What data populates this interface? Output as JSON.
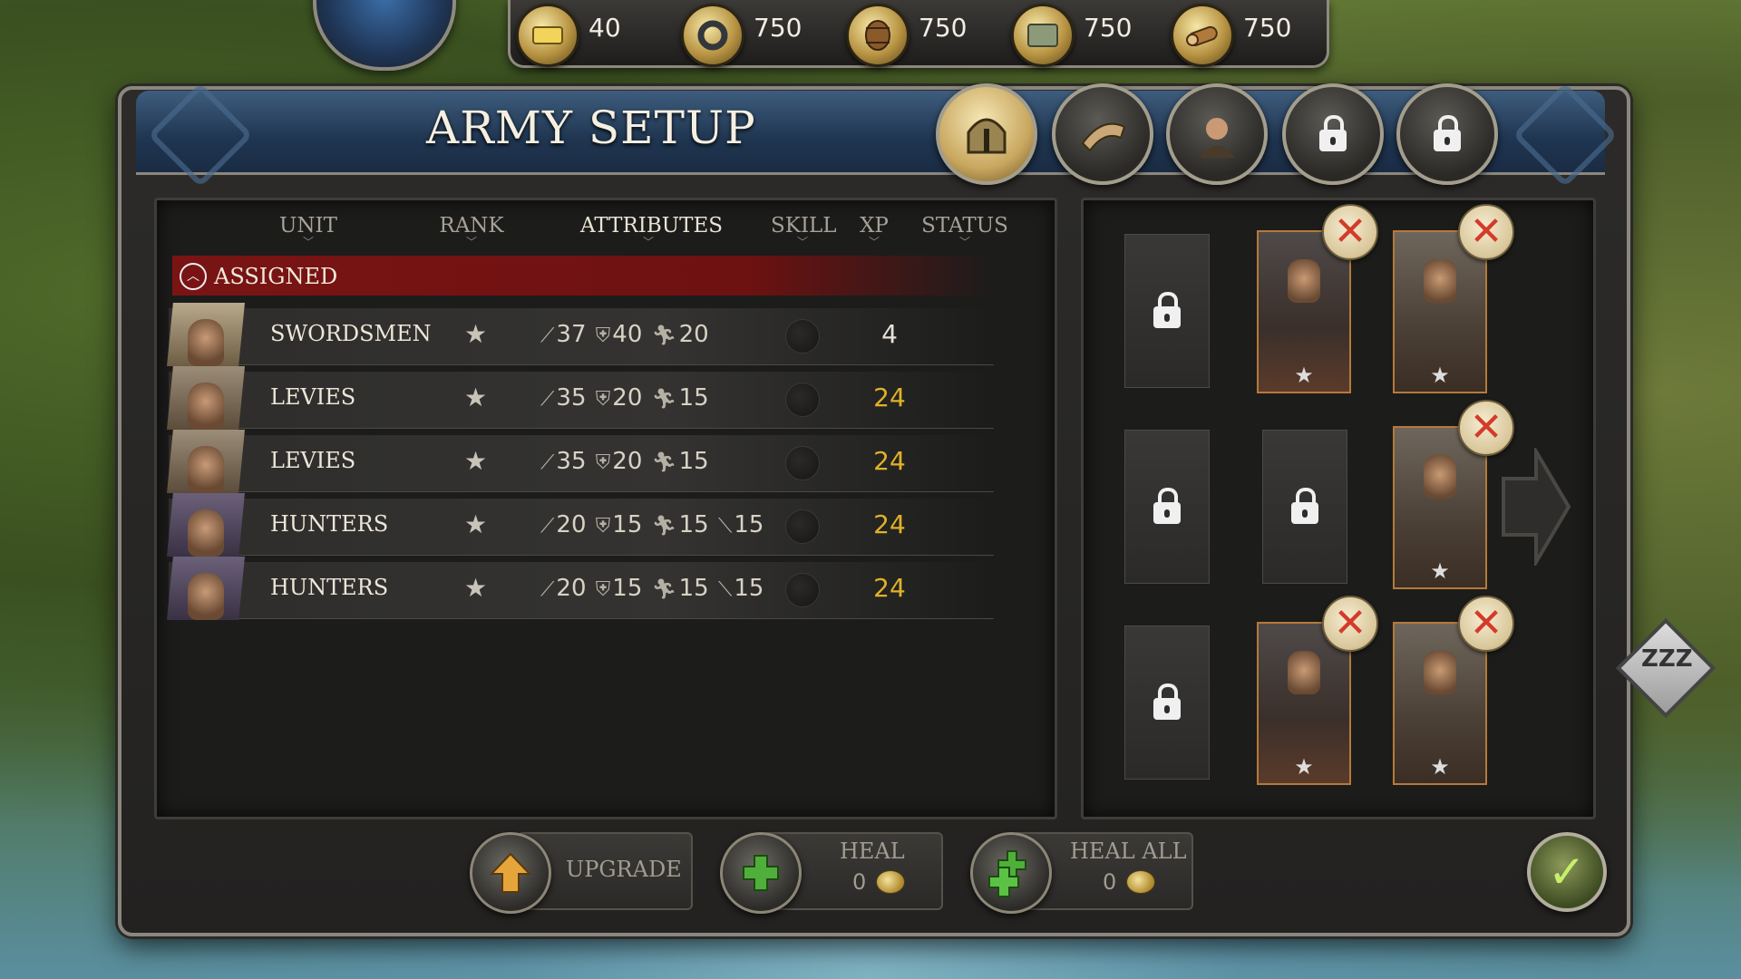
{
  "resources": [
    {
      "icon": "gold-bar-icon",
      "value": "40"
    },
    {
      "icon": "iron-ring-icon",
      "value": "750"
    },
    {
      "icon": "barrel-icon",
      "value": "750"
    },
    {
      "icon": "stone-icon",
      "value": "750"
    },
    {
      "icon": "wood-log-icon",
      "value": "750"
    }
  ],
  "window": {
    "title": "ARMY SETUP"
  },
  "tabs": [
    {
      "icon": "helmet-icon",
      "active": true
    },
    {
      "icon": "horn-icon",
      "active": false
    },
    {
      "icon": "hero-portrait-icon",
      "active": false
    },
    {
      "icon": "locked-banner-icon",
      "active": false
    },
    {
      "icon": "locked-scroll-icon",
      "active": false
    }
  ],
  "table": {
    "columns": [
      "UNIT",
      "RANK",
      "ATTRIBUTES",
      "SKILL",
      "XP",
      "STATUS"
    ],
    "active_column": "ATTRIBUTES",
    "group_label": "ASSIGNED",
    "rows": [
      {
        "unit": "SWORDSMEN",
        "rank": "★",
        "attack": "37",
        "defense": "40",
        "speed": "20",
        "ranged": "",
        "xp": "4",
        "xp_color": "white"
      },
      {
        "unit": "LEVIES",
        "rank": "★",
        "attack": "35",
        "defense": "20",
        "speed": "15",
        "ranged": "",
        "xp": "24",
        "xp_color": "gold"
      },
      {
        "unit": "LEVIES",
        "rank": "★",
        "attack": "35",
        "defense": "20",
        "speed": "15",
        "ranged": "",
        "xp": "24",
        "xp_color": "gold"
      },
      {
        "unit": "HUNTERS",
        "rank": "★",
        "attack": "20",
        "defense": "15",
        "speed": "15",
        "ranged": "15",
        "xp": "24",
        "xp_color": "gold"
      },
      {
        "unit": "HUNTERS",
        "rank": "★",
        "attack": "20",
        "defense": "15",
        "speed": "15",
        "ranged": "15",
        "xp": "24",
        "xp_color": "gold"
      }
    ]
  },
  "formation": {
    "card_star": "★",
    "remove_symbol": "✕"
  },
  "buttons": {
    "upgrade": "UPGRADE",
    "heal": "HEAL",
    "heal_cost": "0",
    "heal_all": "HEAL ALL",
    "heal_all_cost": "0",
    "confirm_symbol": "✓",
    "sleep_symbol": "ZZZ"
  },
  "colors": {
    "gold_text": "#e0b227",
    "assigned_bar": "#7a1414",
    "remove_x": "#d33b2a"
  }
}
